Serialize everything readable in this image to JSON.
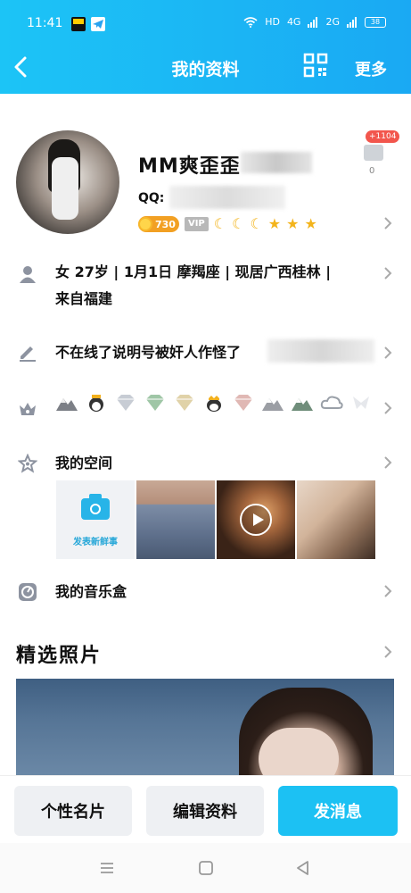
{
  "status_bar": {
    "time": "11:41",
    "network": "HD",
    "signal1": "4G",
    "signal2": "2G",
    "battery": "38"
  },
  "nav": {
    "title": "我的资料",
    "more": "更多"
  },
  "profile": {
    "nickname": "MM爽歪歪",
    "qq_label": "QQ:",
    "coin_value": "730",
    "vip_label": "VIP",
    "likes_badge": "+1104",
    "likes_count": "0"
  },
  "info": {
    "line1": "女  27岁 | 1月1日  摩羯座 | 现居广西桂林 |",
    "line2": "来自福建",
    "signature": "不在线了说明号被奸人作怪了"
  },
  "space": {
    "title": "我的空间",
    "post_label": "发表新鲜事"
  },
  "music": {
    "title": "我的音乐盒"
  },
  "photos": {
    "title": "精选照片"
  },
  "buttons": {
    "card": "个性名片",
    "edit": "编辑资料",
    "message": "发消息"
  },
  "colors": {
    "header_start": "#1cc4f6",
    "header_end": "#1aa9f3",
    "accent": "#1cc1f3"
  }
}
